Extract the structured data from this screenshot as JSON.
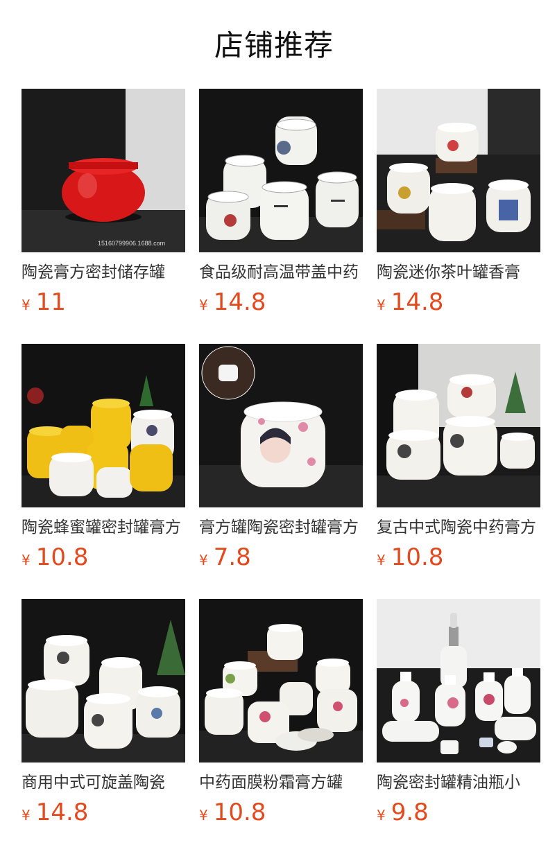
{
  "page": {
    "title": "店铺推荐"
  },
  "theme": {
    "price_color": "#e4481b",
    "title_color": "#333333"
  },
  "products": [
    {
      "title": "陶瓷膏方密封储存罐",
      "currency": "¥",
      "price": "11",
      "image_caption": "15160799906.1688.com",
      "image": "red-ceramic-jar"
    },
    {
      "title": "食品级耐高温带盖中药",
      "currency": "¥",
      "price": "14.8",
      "image": "white-calligraphy-jars"
    },
    {
      "title": "陶瓷迷你茶叶罐香膏",
      "currency": "¥",
      "price": "14.8",
      "image": "mini-tea-jars-on-stand"
    },
    {
      "title": "陶瓷蜂蜜罐密封罐膏方",
      "currency": "¥",
      "price": "10.8",
      "image": "yellow-and-white-honey-jars"
    },
    {
      "title": "膏方罐陶瓷密封罐膏方",
      "currency": "¥",
      "price": "7.8",
      "image": "painted-lady-jar"
    },
    {
      "title": "复古中式陶瓷中药膏方",
      "currency": "¥",
      "price": "10.8",
      "image": "retro-chinese-medicine-jars"
    },
    {
      "title": "商用中式可旋盖陶瓷",
      "currency": "¥",
      "price": "14.8",
      "image": "screw-lid-ceramic-jars"
    },
    {
      "title": "中药面膜粉霜膏方罐",
      "currency": "¥",
      "price": "10.8",
      "image": "floral-face-mask-jars"
    },
    {
      "title": "陶瓷密封罐精油瓶小",
      "currency": "¥",
      "price": "9.8",
      "image": "essential-oil-bottles"
    }
  ]
}
